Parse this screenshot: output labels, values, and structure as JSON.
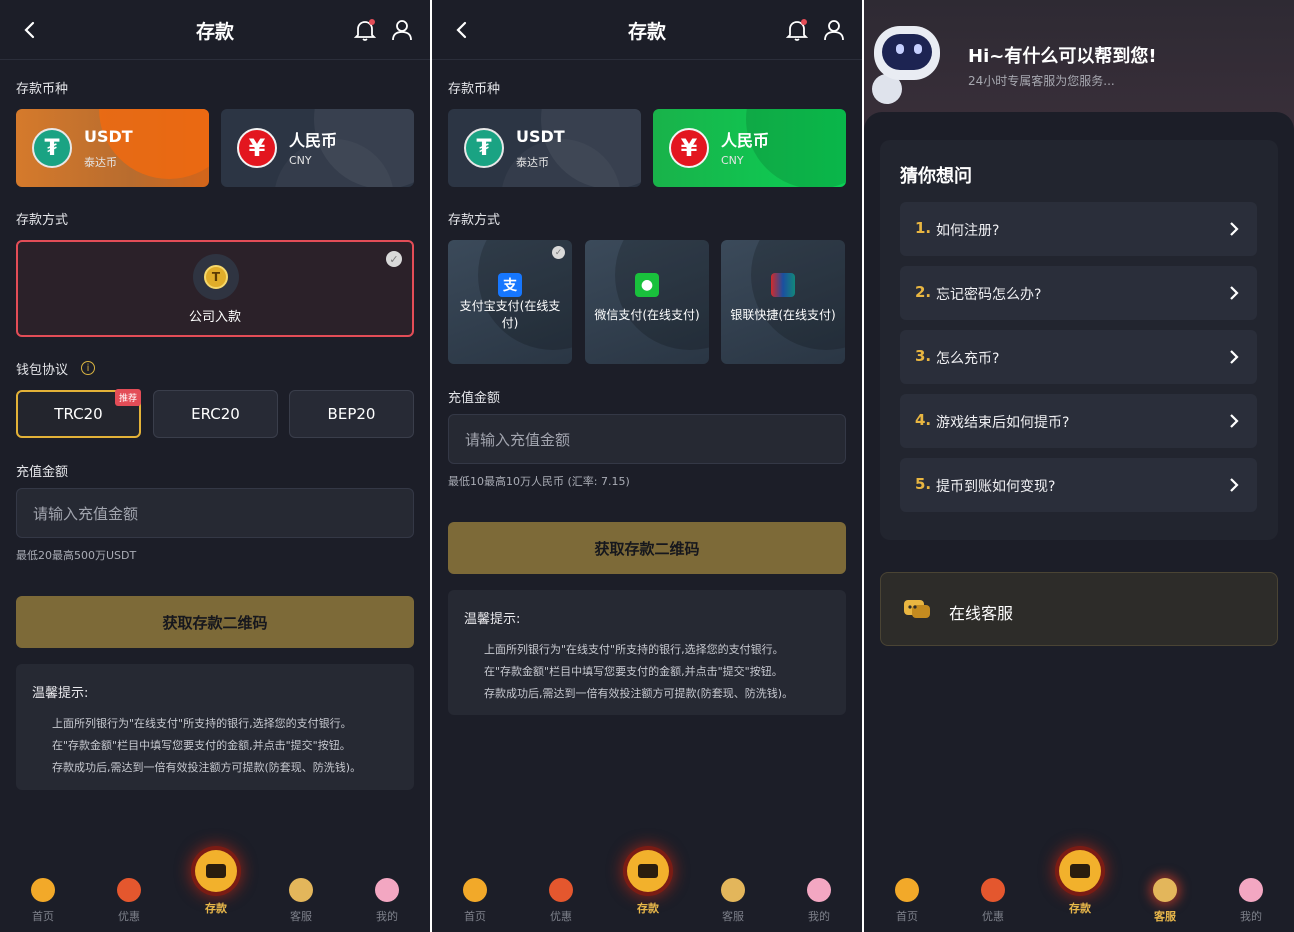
{
  "screen1": {
    "header": {
      "title": "存款"
    },
    "currency_label": "存款币种",
    "currencies": [
      {
        "name": "USDT",
        "sub": "泰达币",
        "selected": true
      },
      {
        "name": "人民币",
        "sub": "CNY",
        "selected": false
      }
    ],
    "method_label": "存款方式",
    "company": {
      "label": "公司入款",
      "selected": true
    },
    "protocol_label": "钱包协议",
    "protocols": [
      {
        "name": "TRC20",
        "selected": true,
        "badge": "推荐"
      },
      {
        "name": "ERC20",
        "selected": false
      },
      {
        "name": "BEP20",
        "selected": false
      }
    ],
    "amount_label": "充值金额",
    "amount_placeholder": "请输入充值金额",
    "limit_hint": "最低20最高500万USDT",
    "submit_label": "获取存款二维码",
    "tips": {
      "title": "温馨提示:",
      "lines": [
        "上面所列银行为\"在线支付\"所支持的银行,选择您的支付银行。",
        "在\"存款金额\"栏目中填写您要支付的金额,并点击\"提交\"按钮。",
        "存款成功后,需达到一倍有效投注额方可提款(防套现、防洗钱)。"
      ]
    }
  },
  "screen2": {
    "header": {
      "title": "存款"
    },
    "currency_label": "存款币种",
    "currencies": [
      {
        "name": "USDT",
        "sub": "泰达币",
        "selected": false
      },
      {
        "name": "人民币",
        "sub": "CNY",
        "selected": true
      }
    ],
    "method_label": "存款方式",
    "methods": [
      {
        "label": "支付宝支付(在线支付)",
        "icon": "alipay-icon",
        "color": "#1677ff",
        "selected": true
      },
      {
        "label": "微信支付(在线支付)",
        "icon": "wechat-icon",
        "color": "#19c13c",
        "selected": false
      },
      {
        "label": "银联快捷(在线支付)",
        "icon": "unionpay-icon",
        "color": "#d22b2b",
        "selected": false
      }
    ],
    "amount_label": "充值金额",
    "amount_placeholder": "请输入充值金额",
    "limit_hint": "最低10最高10万人民币 (汇率: 7.15)",
    "submit_label": "获取存款二维码",
    "tips": {
      "title": "温馨提示:",
      "lines": [
        "上面所列银行为\"在线支付\"所支持的银行,选择您的支付银行。",
        "在\"存款金额\"栏目中填写您要支付的金额,并点击\"提交\"按钮。",
        "存款成功后,需达到一倍有效投注额方可提款(防套现、防洗钱)。"
      ]
    }
  },
  "screen3": {
    "greeting": "Hi~有什么可以帮到您!",
    "subtitle": "24小时专属客服为您服务...",
    "faq_title": "猜你想问",
    "faq": [
      {
        "num": "1.",
        "q": "如何注册?"
      },
      {
        "num": "2.",
        "q": "忘记密码怎么办?"
      },
      {
        "num": "3.",
        "q": "怎么充币?"
      },
      {
        "num": "4.",
        "q": "游戏结束后如何提币?"
      },
      {
        "num": "5.",
        "q": "提币到账如何变现?"
      }
    ],
    "online_service": "在线客服"
  },
  "nav": {
    "items": [
      "首页",
      "优惠",
      "存款",
      "客服",
      "我的"
    ]
  },
  "colors": {
    "bg": "#1c1e28",
    "gold": "#e9b641",
    "button_gold": "#7d6a38",
    "selected_red": "#e34d57",
    "cny_green": "#0bd155",
    "usdt_orange": "#d57a2c"
  }
}
